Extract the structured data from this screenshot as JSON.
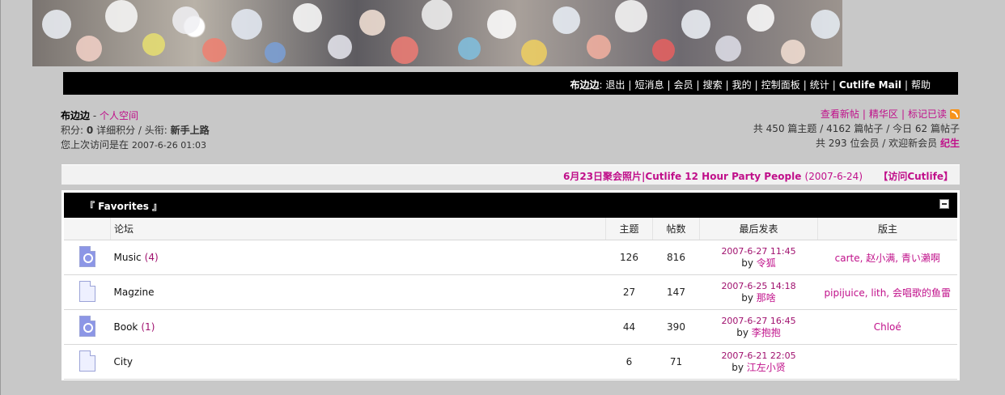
{
  "header": {
    "username": "布边边",
    "nav_items": [
      "退出",
      "短消息",
      "会员",
      "搜索",
      "我的",
      "控制面板",
      "统计",
      "Cutlife Mail",
      "帮助"
    ]
  },
  "user": {
    "name": "布边边",
    "space_link": "个人空间",
    "points_label": "积分:",
    "points": "0",
    "detail_points": "详细积分",
    "title_label": "/ 头衔:",
    "title": "新手上路",
    "last_visit_label": "您上次访问是在",
    "last_visit": "2007-6-26 01:03"
  },
  "stats": {
    "links": [
      "查看新帖",
      "精华区",
      "标记已读"
    ],
    "line1": "共 450 篇主题 / 4162 篇帖子 / 今日 62 篇帖子",
    "line2_prefix": "共 293 位会员 / 欢迎新会员",
    "new_member": "纪生"
  },
  "news": {
    "title": "6月23日聚会照片|Cutlife 12 Hour Party People",
    "date": "(2007-6-24)",
    "visit": "【访问Cutlife】"
  },
  "forum_group": {
    "title": "『 Favorites 』",
    "columns": [
      "论坛",
      "主题",
      "帖数",
      "最后发表",
      "版主"
    ],
    "rows": [
      {
        "name": "Music",
        "count": "(4)",
        "topics": "126",
        "posts": "816",
        "last_date": "2007-6-27 11:45",
        "last_by_label": "by",
        "last_by": "令狐",
        "mods": "carte, 赵小满, 青い瀨啊",
        "new": true
      },
      {
        "name": "Magzine",
        "count": "",
        "topics": "27",
        "posts": "147",
        "last_date": "2007-6-25 14:18",
        "last_by_label": "by",
        "last_by": "那啥",
        "mods": "pipijuice, lith, 会唱歌的鱼雷",
        "new": false
      },
      {
        "name": "Book",
        "count": "(1)",
        "topics": "44",
        "posts": "390",
        "last_date": "2007-6-27 16:45",
        "last_by_label": "by",
        "last_by": "李抱抱",
        "mods": "Chloé",
        "new": true
      },
      {
        "name": "City",
        "count": "",
        "topics": "6",
        "posts": "71",
        "last_date": "2007-6-21 22:05",
        "last_by_label": "by",
        "last_by": "江左小贤",
        "mods": "",
        "new": false
      }
    ]
  },
  "colors": {
    "accent": "#c0108a",
    "nav_bg": "#000000",
    "page_bg": "#c8c8c8"
  }
}
